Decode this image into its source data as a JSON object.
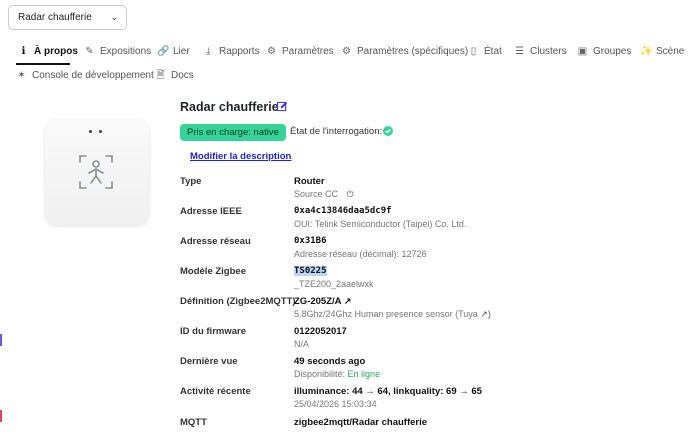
{
  "device_select": {
    "value": "Radar chaufferie"
  },
  "tabs": [
    {
      "label": "À propos",
      "icon": "info-icon",
      "active": true
    },
    {
      "label": "Expositions",
      "icon": "pencil-icon"
    },
    {
      "label": "Lier",
      "icon": "link-icon"
    },
    {
      "label": "Rapports",
      "icon": "download-icon"
    },
    {
      "label": "Paramètres",
      "icon": "cogs-icon"
    },
    {
      "label": "Paramètres (spécifiques)",
      "icon": "gear-icon"
    },
    {
      "label": "État",
      "icon": "file-icon"
    },
    {
      "label": "Clusters",
      "icon": "list-icon"
    },
    {
      "label": "Groupes",
      "icon": "box-icon"
    },
    {
      "label": "Scène",
      "icon": "magic-icon"
    },
    {
      "label": "Console de développement",
      "icon": "bug-icon"
    },
    {
      "label": "Docs",
      "icon": "doc-icon"
    }
  ],
  "device": {
    "name": "Radar chaufferie",
    "support_badge": "Pris en charge: native",
    "interview_label": "État de l'interrogation:",
    "modify_link": "Modifier la description"
  },
  "details": {
    "type": {
      "label": "Type",
      "value": "Router",
      "sub": "Source CC"
    },
    "ieee": {
      "label": "Adresse IEEE",
      "value": "0xa4c13846daa5dc9f",
      "sub": "OUI: Telink Semiconductor (Taipei) Co. Ltd."
    },
    "network": {
      "label": "Adresse réseau",
      "value": "0x31B6",
      "sub": "Adresse réseau (décimal): 12726"
    },
    "model": {
      "label": "Modèle Zigbee",
      "value": "TS0225",
      "sub": "_TZE200_2aaelwxk"
    },
    "definition": {
      "label": "Définition (Zigbee2MQTT)",
      "value": "ZG-205Z/A",
      "sub": "5.8Ghz/24Ghz Human presence sensor (Tuya"
    },
    "firmware": {
      "label": "ID du firmware",
      "value": "0122052017",
      "sub": "N/A"
    },
    "last_seen": {
      "label": "Dernière vue",
      "value": "49 seconds ago",
      "sub_prefix": "Disponibilité:",
      "sub_status": "En ligne"
    },
    "activity": {
      "label": "Activité récente",
      "value": "illuminance: 44 → 64, linkquality: 69 → 65",
      "sub": "25/04/2026 15:03:34"
    },
    "mqtt": {
      "label": "MQTT",
      "value": "zigbee2mqtt/Radar chaufferie"
    }
  },
  "colors": {
    "badge": "#36d399",
    "link": "#1f23c9",
    "online": "#2aa86b",
    "edit_icon": "#3b2fd9"
  }
}
